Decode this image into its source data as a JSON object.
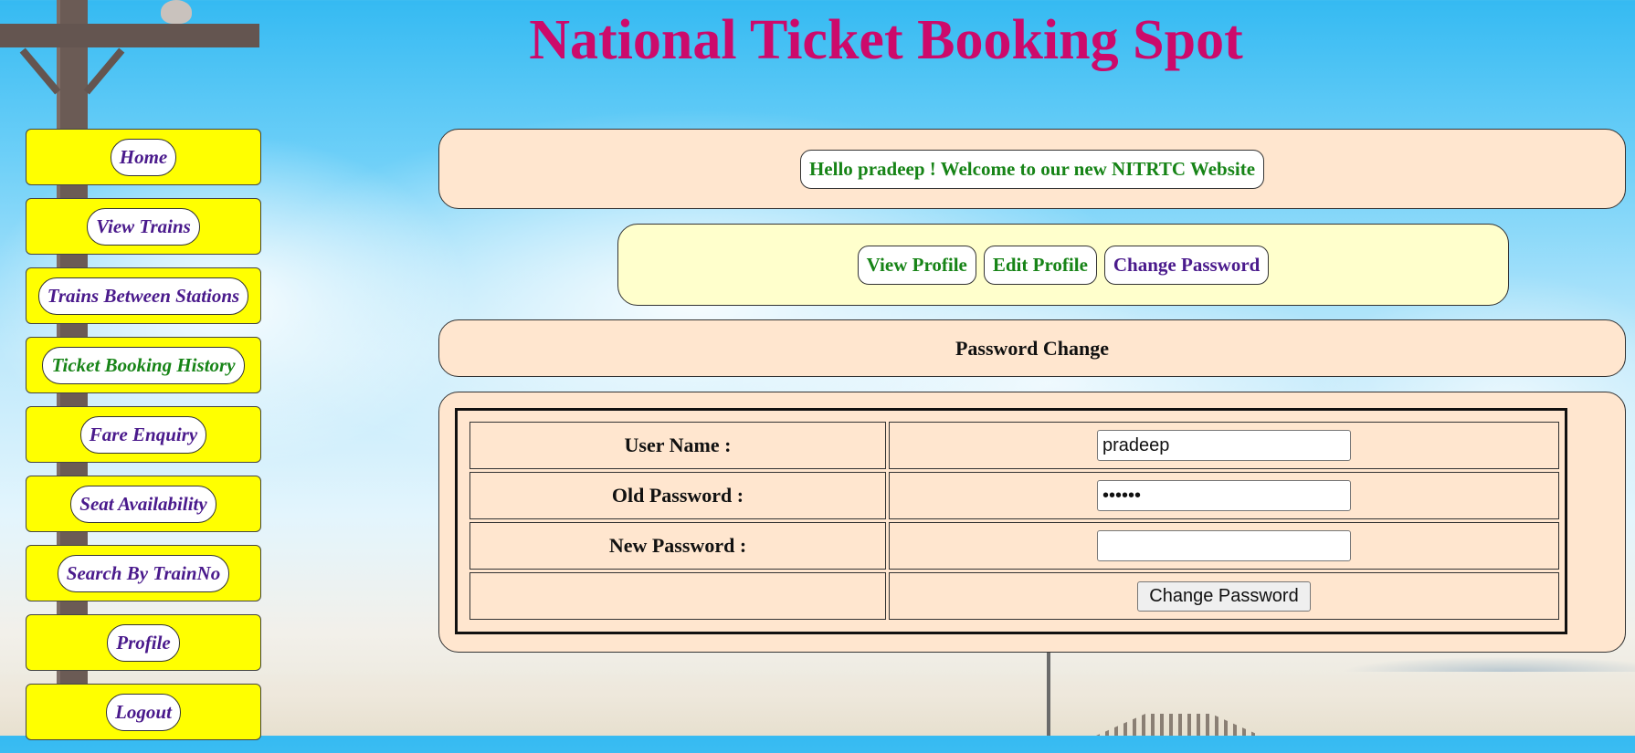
{
  "header": {
    "title": "National Ticket Booking Spot"
  },
  "sidebar": {
    "items": [
      {
        "label": "Home"
      },
      {
        "label": "View Trains"
      },
      {
        "label": "Trains Between Stations"
      },
      {
        "label": "Ticket Booking History"
      },
      {
        "label": "Fare Enquiry"
      },
      {
        "label": "Seat Availability"
      },
      {
        "label": "Search By TrainNo"
      },
      {
        "label": "Profile"
      },
      {
        "label": "Logout"
      }
    ]
  },
  "welcome": {
    "message": "Hello pradeep ! Welcome to our new NITRTC Website"
  },
  "profile_nav": {
    "view_profile": "View Profile",
    "edit_profile": "Edit Profile",
    "change_password": "Change Password"
  },
  "section": {
    "heading": "Password Change"
  },
  "form": {
    "username_label": "User Name :",
    "username_value": "pradeep",
    "old_password_label": "Old Password :",
    "old_password_value": "pradee",
    "new_password_label": "New Password :",
    "new_password_value": "",
    "submit_label": "Change Password"
  },
  "colors": {
    "title": "#cc0a6b",
    "sidebar_card": "#ffff00",
    "nav_text_purple": "#4a1a8c",
    "nav_text_green": "#178417",
    "panel_peach": "#ffe6cf",
    "panel_yellow": "#ffffcc"
  }
}
